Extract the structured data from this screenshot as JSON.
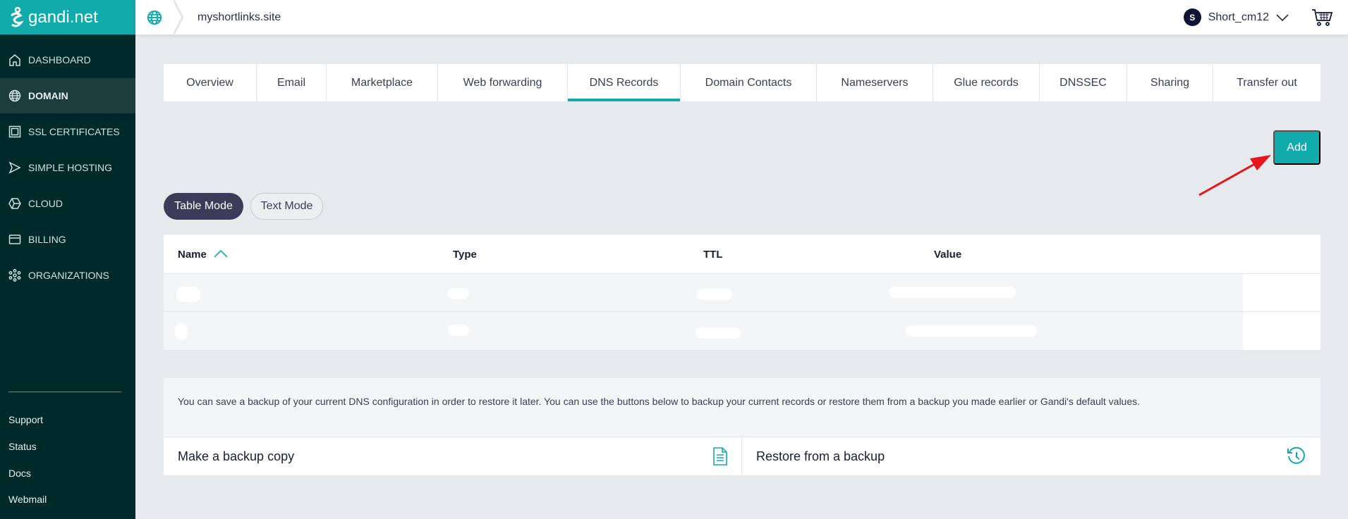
{
  "brand": {
    "name": "gandi.net",
    "accent": "#12abab"
  },
  "sidebar": {
    "items": [
      {
        "label": "Dashboard",
        "icon": "home-icon"
      },
      {
        "label": "Domain",
        "icon": "globe-icon",
        "active": true
      },
      {
        "label": "SSL Certificates",
        "icon": "certificate-icon"
      },
      {
        "label": "Simple Hosting",
        "icon": "send-icon"
      },
      {
        "label": "Cloud",
        "icon": "cube-icon"
      },
      {
        "label": "Billing",
        "icon": "card-icon"
      },
      {
        "label": "Organizations",
        "icon": "network-icon"
      }
    ],
    "footer": [
      "Support",
      "Status",
      "Docs",
      "Webmail"
    ]
  },
  "header": {
    "domain": "myshortlinks.site",
    "user_initial": "S",
    "user_name": "Short_cm12"
  },
  "tabs": [
    "Overview",
    "Email",
    "Marketplace",
    "Web forwarding",
    "DNS Records",
    "Domain Contacts",
    "Nameservers",
    "Glue records",
    "DNSSEC",
    "Sharing",
    "Transfer out"
  ],
  "active_tab": "DNS Records",
  "add_label": "Add",
  "modes": {
    "table": "Table Mode",
    "text": "Text Mode",
    "selected": "Table Mode"
  },
  "table": {
    "columns": [
      "Name",
      "Type",
      "TTL",
      "Value"
    ],
    "sort": "Name ascending",
    "rows": 2
  },
  "backup": {
    "description": "You can save a backup of your current DNS configuration in order to restore it later. You can use the buttons below to backup your current records or restore them from a backup you made earlier or Gandi's default values.",
    "make": "Make a backup copy",
    "restore": "Restore from a backup"
  }
}
